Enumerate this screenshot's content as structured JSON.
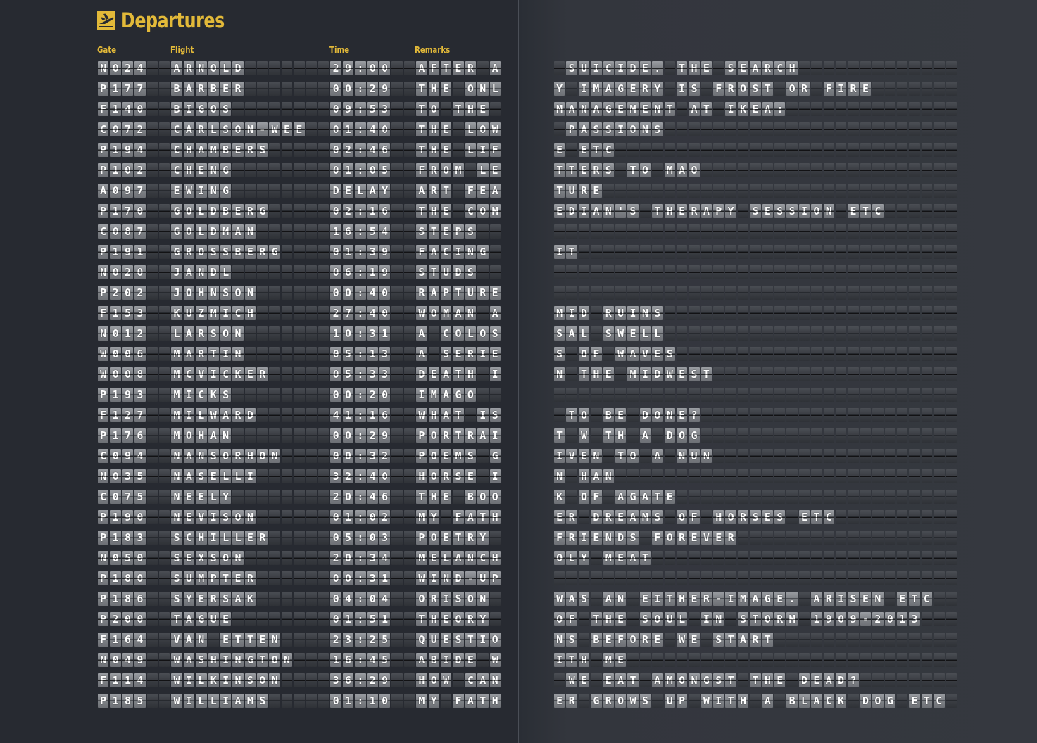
{
  "title": "Departures",
  "headers": {
    "gate": "Gate",
    "flight": "Flight",
    "time": "Time",
    "remarks": "Remarks"
  },
  "colors": {
    "accent": "#e2b939",
    "background": "#272a31",
    "tile_light": "#8a8d92",
    "tile_dark": "#3a3d43"
  },
  "rows": [
    {
      "gate": "N024",
      "flight": "ARNOLD",
      "time": "29:00",
      "remarks": "AFTER A",
      "remarks_right": " SUICIDE. THE SEARCH"
    },
    {
      "gate": "P177",
      "flight": "BARBER",
      "time": "00:29",
      "remarks": "THE ONL",
      "remarks_right": "Y IMAGERY IS FROST OR FIRE"
    },
    {
      "gate": "F140",
      "flight": "BIGOS",
      "time": "09:53",
      "remarks": "TO THE ",
      "remarks_right": "MANAGEMENT AT IKEA:"
    },
    {
      "gate": "C072",
      "flight": "CARLSON-WEE",
      "time": "01:40",
      "remarks": "THE LOW",
      "remarks_right": " PASSIONS"
    },
    {
      "gate": "P194",
      "flight": "CHAMBERS",
      "time": "02:46",
      "remarks": "THE LIF",
      "remarks_right": "E ETC"
    },
    {
      "gate": "P102",
      "flight": "CHENG",
      "time": "01:05",
      "remarks": "FROM LE",
      "remarks_right": "TTERS TO MAO"
    },
    {
      "gate": "A097",
      "flight": "EWING",
      "time": "DELAY",
      "remarks": "ART FEA",
      "remarks_right": "TURE"
    },
    {
      "gate": "P170",
      "flight": "GOLDBERG",
      "time": "02:16",
      "remarks": "THE COM",
      "remarks_right": "EDIAN'S THERAPY SESSION ETC"
    },
    {
      "gate": "C087",
      "flight": "GOLDMAN",
      "time": "16:54",
      "remarks": "STEPS",
      "remarks_right": ""
    },
    {
      "gate": "P191",
      "flight": "GROSSBERG",
      "time": "01:39",
      "remarks": "FACING",
      "remarks_right": "IT"
    },
    {
      "gate": "N020",
      "flight": "JANDL",
      "time": "06:19",
      "remarks": "STUDS",
      "remarks_right": ""
    },
    {
      "gate": "P202",
      "flight": "JOHNSON",
      "time": "00:40",
      "remarks": "RAPTURE",
      "remarks_right": ""
    },
    {
      "gate": "F153",
      "flight": "KUZMICH",
      "time": "27:40",
      "remarks": "WOMAN A",
      "remarks_right": "MID RUINS"
    },
    {
      "gate": "N012",
      "flight": "LARSON",
      "time": "10:31",
      "remarks": "A COLOS",
      "remarks_right": "SAL SWELL"
    },
    {
      "gate": "W006",
      "flight": "MARTIN",
      "time": "05:13",
      "remarks": "A SERIE",
      "remarks_right": "S OF WAVES"
    },
    {
      "gate": "W008",
      "flight": "MCVICKER",
      "time": "05:33",
      "remarks": "DEATH I",
      "remarks_right": "N THE MIDWEST"
    },
    {
      "gate": "P193",
      "flight": "MICKS",
      "time": "00:20",
      "remarks": "IMAGO",
      "remarks_right": ""
    },
    {
      "gate": "F127",
      "flight": "MILWARD",
      "time": "41:16",
      "remarks": "WHAT IS",
      "remarks_right": " TO BE DONE?"
    },
    {
      "gate": "P176",
      "flight": "MOHAN",
      "time": "00:29",
      "remarks": "PORTRAI",
      "remarks_right": "T W TH A DOG"
    },
    {
      "gate": "C094",
      "flight": "NANSORHON",
      "time": "00:32",
      "remarks": "POEMS G",
      "remarks_right": "IVEN TO A NUN"
    },
    {
      "gate": "N035",
      "flight": "NASELLI",
      "time": "32:40",
      "remarks": "HORSE I",
      "remarks_right": "N HAN"
    },
    {
      "gate": "C075",
      "flight": "NEELY",
      "time": "20:46",
      "remarks": "THE BOO",
      "remarks_right": "K OF AGATE"
    },
    {
      "gate": "P190",
      "flight": "NEVISON",
      "time": "01:02",
      "remarks": "MY FATH",
      "remarks_right": "ER DREAMS OF HORSES ETC"
    },
    {
      "gate": "P183",
      "flight": "SCHILLER",
      "time": "05:03",
      "remarks": "POETRY",
      "remarks_right": "FRIENDS FOREVER"
    },
    {
      "gate": "N050",
      "flight": "SEXSON",
      "time": "20:34",
      "remarks": "MELANCH",
      "remarks_right": "OLY MEAT"
    },
    {
      "gate": "P180",
      "flight": "SUMPTER",
      "time": "00:31",
      "remarks": "WIND-UP",
      "remarks_right": ""
    },
    {
      "gate": "P186",
      "flight": "SYERSAK",
      "time": "04:04",
      "remarks": "ORISON",
      "remarks_right": "WAS AN EITHER-IMAGE. ARISEN ETC"
    },
    {
      "gate": "P200",
      "flight": "TAGUE",
      "time": "01:51",
      "remarks": "THEORY",
      "remarks_right": "OF THE SOUL IN STORM 1909-2013"
    },
    {
      "gate": "F164",
      "flight": "VAN ETTEN",
      "time": "23:25",
      "remarks": "QUESTIO",
      "remarks_right": "NS BEFORE WE START"
    },
    {
      "gate": "N049",
      "flight": "WASHINGTON",
      "time": "16:45",
      "remarks": "ABIDE W",
      "remarks_right": "ITH ME"
    },
    {
      "gate": "F114",
      "flight": "WILKINSON",
      "time": "36:29",
      "remarks": "HOW CAN",
      "remarks_right": " WE EAT AMONGST THE DEAD?"
    },
    {
      "gate": "P185",
      "flight": "WILLIAMS",
      "time": "01:10",
      "remarks": "MY FATH",
      "remarks_right": "ER GROWS UP WITH A BLACK DOG ETC"
    }
  ]
}
